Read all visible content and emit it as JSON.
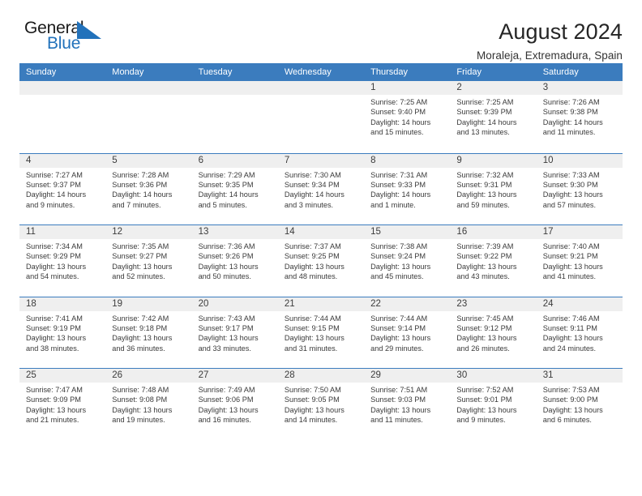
{
  "brand": {
    "name_part1": "General",
    "name_part2": "Blue",
    "mark": "triangle-logo"
  },
  "header": {
    "title": "August 2024",
    "location": "Moraleja, Extremadura, Spain"
  },
  "weekdays": [
    "Sunday",
    "Monday",
    "Tuesday",
    "Wednesday",
    "Thursday",
    "Friday",
    "Saturday"
  ],
  "colors": {
    "header_blue": "#3b7cbe",
    "logo_blue": "#2272bb",
    "day_band_gray": "#efefef",
    "text": "#333333"
  },
  "weeks": [
    [
      {
        "day": "",
        "info": ""
      },
      {
        "day": "",
        "info": ""
      },
      {
        "day": "",
        "info": ""
      },
      {
        "day": "",
        "info": ""
      },
      {
        "day": "1",
        "info": "Sunrise: 7:25 AM\nSunset: 9:40 PM\nDaylight: 14 hours and 15 minutes."
      },
      {
        "day": "2",
        "info": "Sunrise: 7:25 AM\nSunset: 9:39 PM\nDaylight: 14 hours and 13 minutes."
      },
      {
        "day": "3",
        "info": "Sunrise: 7:26 AM\nSunset: 9:38 PM\nDaylight: 14 hours and 11 minutes."
      }
    ],
    [
      {
        "day": "4",
        "info": "Sunrise: 7:27 AM\nSunset: 9:37 PM\nDaylight: 14 hours and 9 minutes."
      },
      {
        "day": "5",
        "info": "Sunrise: 7:28 AM\nSunset: 9:36 PM\nDaylight: 14 hours and 7 minutes."
      },
      {
        "day": "6",
        "info": "Sunrise: 7:29 AM\nSunset: 9:35 PM\nDaylight: 14 hours and 5 minutes."
      },
      {
        "day": "7",
        "info": "Sunrise: 7:30 AM\nSunset: 9:34 PM\nDaylight: 14 hours and 3 minutes."
      },
      {
        "day": "8",
        "info": "Sunrise: 7:31 AM\nSunset: 9:33 PM\nDaylight: 14 hours and 1 minute."
      },
      {
        "day": "9",
        "info": "Sunrise: 7:32 AM\nSunset: 9:31 PM\nDaylight: 13 hours and 59 minutes."
      },
      {
        "day": "10",
        "info": "Sunrise: 7:33 AM\nSunset: 9:30 PM\nDaylight: 13 hours and 57 minutes."
      }
    ],
    [
      {
        "day": "11",
        "info": "Sunrise: 7:34 AM\nSunset: 9:29 PM\nDaylight: 13 hours and 54 minutes."
      },
      {
        "day": "12",
        "info": "Sunrise: 7:35 AM\nSunset: 9:27 PM\nDaylight: 13 hours and 52 minutes."
      },
      {
        "day": "13",
        "info": "Sunrise: 7:36 AM\nSunset: 9:26 PM\nDaylight: 13 hours and 50 minutes."
      },
      {
        "day": "14",
        "info": "Sunrise: 7:37 AM\nSunset: 9:25 PM\nDaylight: 13 hours and 48 minutes."
      },
      {
        "day": "15",
        "info": "Sunrise: 7:38 AM\nSunset: 9:24 PM\nDaylight: 13 hours and 45 minutes."
      },
      {
        "day": "16",
        "info": "Sunrise: 7:39 AM\nSunset: 9:22 PM\nDaylight: 13 hours and 43 minutes."
      },
      {
        "day": "17",
        "info": "Sunrise: 7:40 AM\nSunset: 9:21 PM\nDaylight: 13 hours and 41 minutes."
      }
    ],
    [
      {
        "day": "18",
        "info": "Sunrise: 7:41 AM\nSunset: 9:19 PM\nDaylight: 13 hours and 38 minutes."
      },
      {
        "day": "19",
        "info": "Sunrise: 7:42 AM\nSunset: 9:18 PM\nDaylight: 13 hours and 36 minutes."
      },
      {
        "day": "20",
        "info": "Sunrise: 7:43 AM\nSunset: 9:17 PM\nDaylight: 13 hours and 33 minutes."
      },
      {
        "day": "21",
        "info": "Sunrise: 7:44 AM\nSunset: 9:15 PM\nDaylight: 13 hours and 31 minutes."
      },
      {
        "day": "22",
        "info": "Sunrise: 7:44 AM\nSunset: 9:14 PM\nDaylight: 13 hours and 29 minutes."
      },
      {
        "day": "23",
        "info": "Sunrise: 7:45 AM\nSunset: 9:12 PM\nDaylight: 13 hours and 26 minutes."
      },
      {
        "day": "24",
        "info": "Sunrise: 7:46 AM\nSunset: 9:11 PM\nDaylight: 13 hours and 24 minutes."
      }
    ],
    [
      {
        "day": "25",
        "info": "Sunrise: 7:47 AM\nSunset: 9:09 PM\nDaylight: 13 hours and 21 minutes."
      },
      {
        "day": "26",
        "info": "Sunrise: 7:48 AM\nSunset: 9:08 PM\nDaylight: 13 hours and 19 minutes."
      },
      {
        "day": "27",
        "info": "Sunrise: 7:49 AM\nSunset: 9:06 PM\nDaylight: 13 hours and 16 minutes."
      },
      {
        "day": "28",
        "info": "Sunrise: 7:50 AM\nSunset: 9:05 PM\nDaylight: 13 hours and 14 minutes."
      },
      {
        "day": "29",
        "info": "Sunrise: 7:51 AM\nSunset: 9:03 PM\nDaylight: 13 hours and 11 minutes."
      },
      {
        "day": "30",
        "info": "Sunrise: 7:52 AM\nSunset: 9:01 PM\nDaylight: 13 hours and 9 minutes."
      },
      {
        "day": "31",
        "info": "Sunrise: 7:53 AM\nSunset: 9:00 PM\nDaylight: 13 hours and 6 minutes."
      }
    ]
  ]
}
